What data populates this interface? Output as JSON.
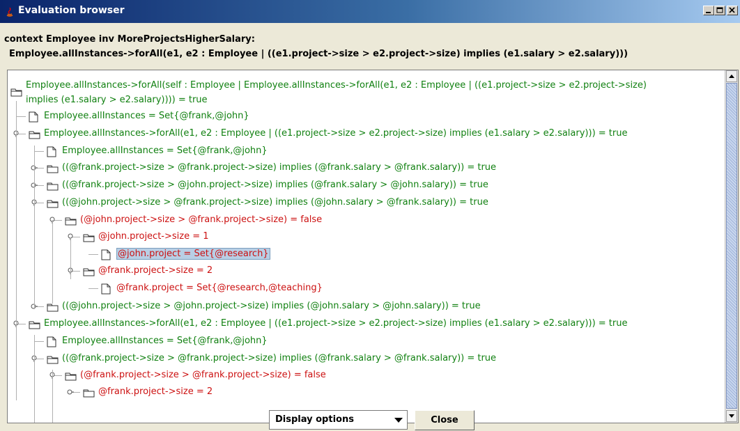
{
  "window": {
    "title": "Evaluation browser",
    "minimize_icon": "minimize-icon",
    "maximize_icon": "maximize-icon",
    "close_icon": "close-icon"
  },
  "header": {
    "line1": "context Employee inv MoreProjectsHigherSalary:",
    "line2": "Employee.allInstances->forAll(e1, e2 : Employee | ((e1.project->size > e2.project->size) implies (e1.salary > e2.salary)))"
  },
  "tree": {
    "nodes": [
      {
        "text": "Employee.allInstances->forAll(self : Employee | Employee.allInstances->forAll(e1, e2 : Employee | ((e1.project->size > e2.project->size)",
        "text2": "implies (e1.salary > e2.salary)))) = true",
        "color": "green",
        "icon": "folder-open-icon",
        "level": 0
      },
      {
        "text": "Employee.allInstances = Set{@frank,@john}",
        "color": "green",
        "icon": "document-icon",
        "level": 1
      },
      {
        "text": "Employee.allInstances->forAll(e1, e2 : Employee | ((e1.project->size > e2.project->size) implies (e1.salary > e2.salary))) = true",
        "color": "green",
        "icon": "folder-open-icon",
        "level": 1
      },
      {
        "text": "Employee.allInstances = Set{@frank,@john}",
        "color": "green",
        "icon": "document-icon",
        "level": 2
      },
      {
        "text": "((@frank.project->size > @frank.project->size) implies (@frank.salary > @frank.salary)) = true",
        "color": "green",
        "icon": "folder-icon",
        "level": 2
      },
      {
        "text": "((@frank.project->size > @john.project->size) implies (@frank.salary > @john.salary)) = true",
        "color": "green",
        "icon": "folder-icon",
        "level": 2
      },
      {
        "text": "((@john.project->size > @frank.project->size) implies (@john.salary > @frank.salary)) = true",
        "color": "green",
        "icon": "folder-open-icon",
        "level": 2
      },
      {
        "text": "(@john.project->size > @frank.project->size) = false",
        "color": "red",
        "icon": "folder-open-icon",
        "level": 3
      },
      {
        "text": "@john.project->size = 1",
        "color": "red",
        "icon": "folder-open-icon",
        "level": 4
      },
      {
        "text": "@john.project = Set{@research}",
        "color": "red",
        "icon": "document-icon",
        "level": 5,
        "selected": true
      },
      {
        "text": "@frank.project->size = 2",
        "color": "red",
        "icon": "folder-open-icon",
        "level": 4
      },
      {
        "text": "@frank.project = Set{@research,@teaching}",
        "color": "red",
        "icon": "document-icon",
        "level": 5
      },
      {
        "text": "((@john.project->size > @john.project->size) implies (@john.salary > @john.salary)) = true",
        "color": "green",
        "icon": "folder-icon",
        "level": 2
      },
      {
        "text": "Employee.allInstances->forAll(e1, e2 : Employee | ((e1.project->size > e2.project->size) implies (e1.salary > e2.salary))) = true",
        "color": "green",
        "icon": "folder-open-icon",
        "level": 1
      },
      {
        "text": "Employee.allInstances = Set{@frank,@john}",
        "color": "green",
        "icon": "document-icon",
        "level": 2
      },
      {
        "text": "((@frank.project->size > @frank.project->size) implies (@frank.salary > @frank.salary)) = true",
        "color": "green",
        "icon": "folder-open-icon",
        "level": 2
      },
      {
        "text": "(@frank.project->size > @frank.project->size) = false",
        "color": "red",
        "icon": "folder-open-icon",
        "level": 3
      },
      {
        "text": "@frank.project->size = 2",
        "color": "red",
        "icon": "folder-icon",
        "level": 4
      }
    ]
  },
  "footer": {
    "display_options": "Display options",
    "close": "Close"
  },
  "colors": {
    "green": "#108010",
    "red": "#cc1111",
    "selection": "#b8cfe5"
  }
}
